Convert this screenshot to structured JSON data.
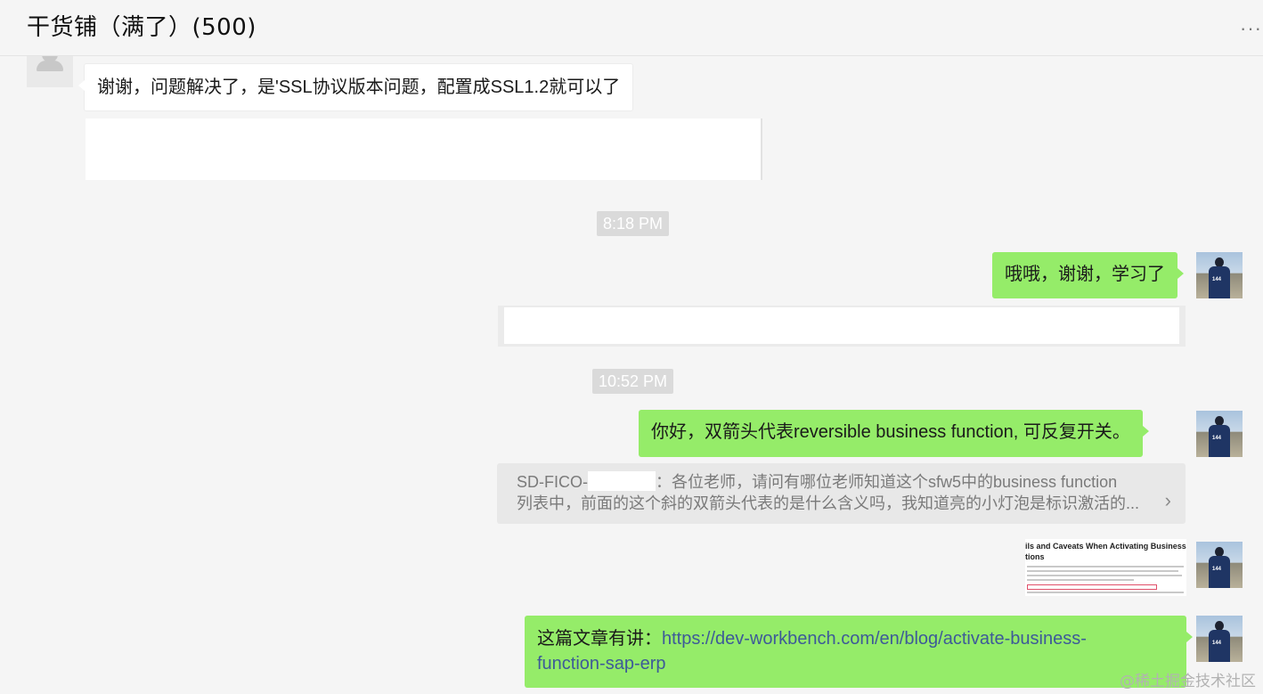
{
  "header": {
    "title": "干货铺（满了）(500)",
    "more_label": "···"
  },
  "messages": {
    "m1_text": "谢谢，问题解决了，是'SSL协议版本问题，配置成SSL1.2就可以了",
    "ts1": "8:18 PM",
    "m2_text": "哦哦，谢谢，学习了",
    "ts2": "10:52 PM",
    "m3_text": "你好，双箭头代表reversible business function, 可反复开关。",
    "quote_sender": "SD-FICO-",
    "quote_line1_rest": "：各位老师，请问有哪位老师知道这个sfw5中的business function",
    "quote_line2": "列表中，前面的这个斜的双箭头代表的是什么含义吗，我知道亮的小灯泡是标识激活的...",
    "quote_chevron": "›",
    "thumb_title": "ils and Caveats When Activating Business tions",
    "m4_prefix": "这篇文章有讲：",
    "m4_link_line1": "https://dev-workbench.com/en/blog/activate-business-",
    "m4_link_line2": "function-sap-erp"
  },
  "avatar_jersey_number": "144",
  "watermark": "@稀土掘金技术社区",
  "colors": {
    "background": "#f5f5f5",
    "bubble_sent": "#95ec69",
    "bubble_received": "#ffffff",
    "link": "#3d5a98",
    "timestamp_bg": "#dadada"
  }
}
